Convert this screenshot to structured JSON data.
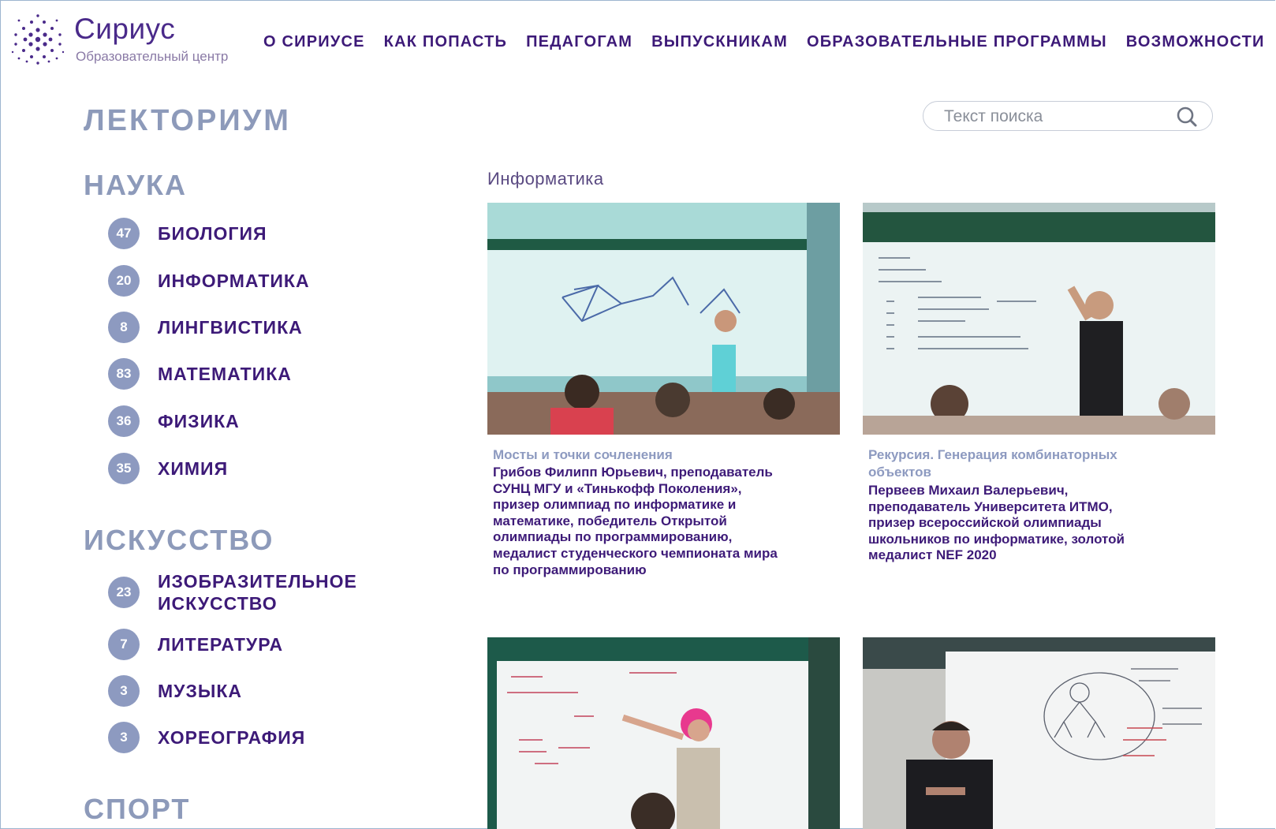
{
  "header": {
    "logo_name": "Сириус",
    "logo_subtitle": "Образовательный центр",
    "nav": [
      "О СИРИУСЕ",
      "КАК ПОПАСТЬ",
      "ПЕДАГОГАМ",
      "ВЫПУСКНИКАМ",
      "ОБРАЗОВАТЕЛЬНЫЕ ПРОГРАММЫ",
      "ВОЗМОЖНОСТИ"
    ]
  },
  "page_title": "ЛЕКТОРИУМ",
  "search": {
    "placeholder": "Текст поиска"
  },
  "sections": [
    {
      "title": "НАУКА",
      "items": [
        {
          "count": "47",
          "label": "БИОЛОГИЯ"
        },
        {
          "count": "20",
          "label": "ИНФОРМАТИКА"
        },
        {
          "count": "8",
          "label": "ЛИНГВИСТИКА"
        },
        {
          "count": "83",
          "label": "МАТЕМАТИКА"
        },
        {
          "count": "36",
          "label": "ФИЗИКА"
        },
        {
          "count": "35",
          "label": "ХИМИЯ"
        }
      ]
    },
    {
      "title": "ИСКУССТВО",
      "items": [
        {
          "count": "23",
          "label_line1": "ИЗОБРАЗИТЕЛЬНОЕ",
          "label_line2": "ИСКУССТВО"
        },
        {
          "count": "7",
          "label": "ЛИТЕРАТУРА"
        },
        {
          "count": "3",
          "label": "МУЗЫКА"
        },
        {
          "count": "3",
          "label": "ХОРЕОГРАФИЯ"
        }
      ]
    },
    {
      "title": "СПОРТ"
    }
  ],
  "content": {
    "heading": "Информатика",
    "cards": [
      {
        "title": "Мосты и точки сочленения",
        "desc_lines": [
          "Грибов Филипп Юрьевич, преподаватель",
          "СУНЦ МГУ и «Тинькофф Поколения»,",
          "призер олимпиад по информатике и",
          "математике, победитель Открытой",
          "олимпиады по программированию,",
          "медалист студенческого чемпионата мира",
          "по программированию"
        ]
      },
      {
        "title_lines": [
          "Рекурсия. Генерация комбинаторных",
          "объектов"
        ],
        "desc_lines": [
          "Первеев Михаил Валерьевич,",
          "преподаватель Университета ИТМО,",
          "призер всероссийской олимпиады",
          "школьников по информатике, золотой",
          "медалист NEF 2020"
        ]
      }
    ]
  }
}
